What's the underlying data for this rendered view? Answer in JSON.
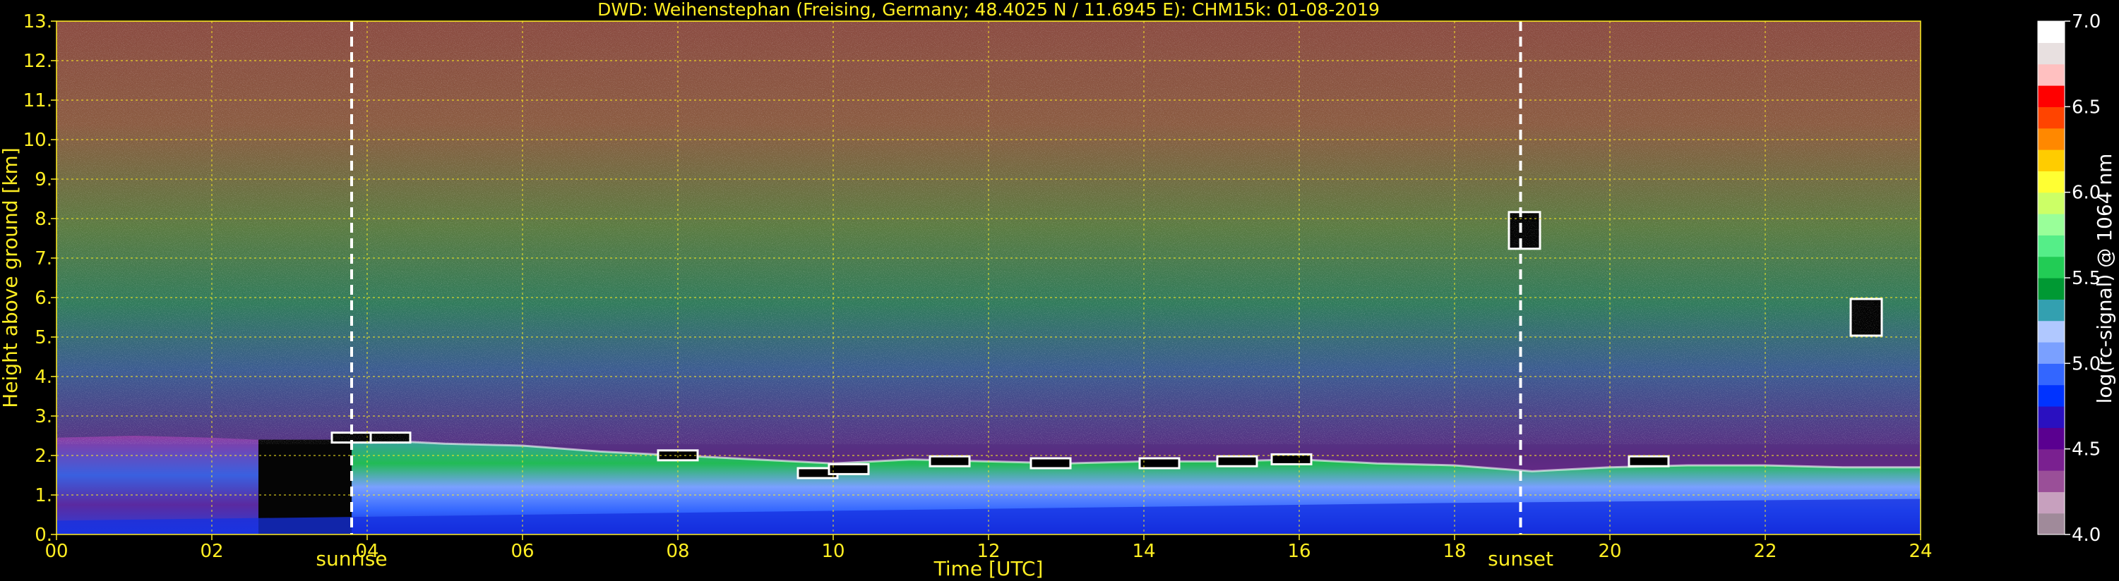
{
  "chart_data": {
    "type": "heatmap",
    "title": "DWD: Weihenstephan (Freising, Germany; 48.4025 N / 11.6945 E):    CHM15k: 01-08-2019",
    "xlabel": "Time [UTC]",
    "ylabel": "Height above ground [km]",
    "xlim": [
      0,
      24
    ],
    "ylim": [
      0,
      13
    ],
    "x_ticks": [
      "00",
      "02",
      "04",
      "06",
      "08",
      "10",
      "12",
      "14",
      "16",
      "18",
      "20",
      "22",
      "24"
    ],
    "y_ticks": [
      "0.",
      "1.",
      "2.",
      "3.",
      "4.",
      "5.",
      "6.",
      "7.",
      "8.",
      "9.",
      "10.",
      "11.",
      "12.",
      "13."
    ],
    "grid": true,
    "colorbar": {
      "label": "log(rc-signal) @ 1064 nm",
      "range": [
        4.0,
        7.0
      ],
      "ticks": [
        "4.0",
        "4.5",
        "5.0",
        "5.5",
        "6.0",
        "6.5",
        "7.0"
      ],
      "colors": [
        "#a08a9a",
        "#c7a0be",
        "#9a4f98",
        "#7a2090",
        "#5a0090",
        "#2a10c0",
        "#0033ff",
        "#3366ff",
        "#7aa0ff",
        "#b0c8ff",
        "#33a0b0",
        "#009933",
        "#22cc55",
        "#55ee88",
        "#99ff99",
        "#ccff66",
        "#ffff33",
        "#ffcc00",
        "#ff8800",
        "#ff4400",
        "#ff0000",
        "#ffc0c0",
        "#e8e0e0",
        "#ffffff"
      ]
    },
    "markers": [
      {
        "label": "sunrise",
        "time_utc": 3.8
      },
      {
        "label": "sunset",
        "time_utc": 18.85
      }
    ],
    "mixing_layer_height_km": [
      [
        0,
        2.45
      ],
      [
        2,
        2.45
      ],
      [
        2.6,
        2.4
      ],
      [
        3.5,
        2.35
      ],
      [
        4,
        2.4
      ],
      [
        5,
        2.3
      ],
      [
        6,
        2.25
      ],
      [
        7,
        2.1
      ],
      [
        8,
        2.0
      ],
      [
        9,
        1.9
      ],
      [
        10,
        1.8
      ],
      [
        11,
        1.9
      ],
      [
        12,
        1.85
      ],
      [
        13,
        1.8
      ],
      [
        14,
        1.85
      ],
      [
        15,
        1.85
      ],
      [
        16,
        1.9
      ],
      [
        17,
        1.8
      ],
      [
        18,
        1.75
      ],
      [
        19,
        1.6
      ],
      [
        20,
        1.7
      ],
      [
        21,
        1.75
      ],
      [
        22,
        1.75
      ],
      [
        23,
        1.7
      ],
      [
        24,
        1.7
      ]
    ],
    "cloud_base_km": [
      [
        3.8,
        2.4
      ],
      [
        4.3,
        2.4
      ],
      [
        8.0,
        1.95
      ],
      [
        9.8,
        1.5
      ],
      [
        10.2,
        1.6
      ],
      [
        11.5,
        1.8
      ],
      [
        12.8,
        1.75
      ],
      [
        14.2,
        1.75
      ],
      [
        15.2,
        1.8
      ],
      [
        15.9,
        1.85
      ],
      [
        20.5,
        1.8
      ],
      [
        18.9,
        7.7
      ],
      [
        23.3,
        5.5
      ]
    ]
  }
}
